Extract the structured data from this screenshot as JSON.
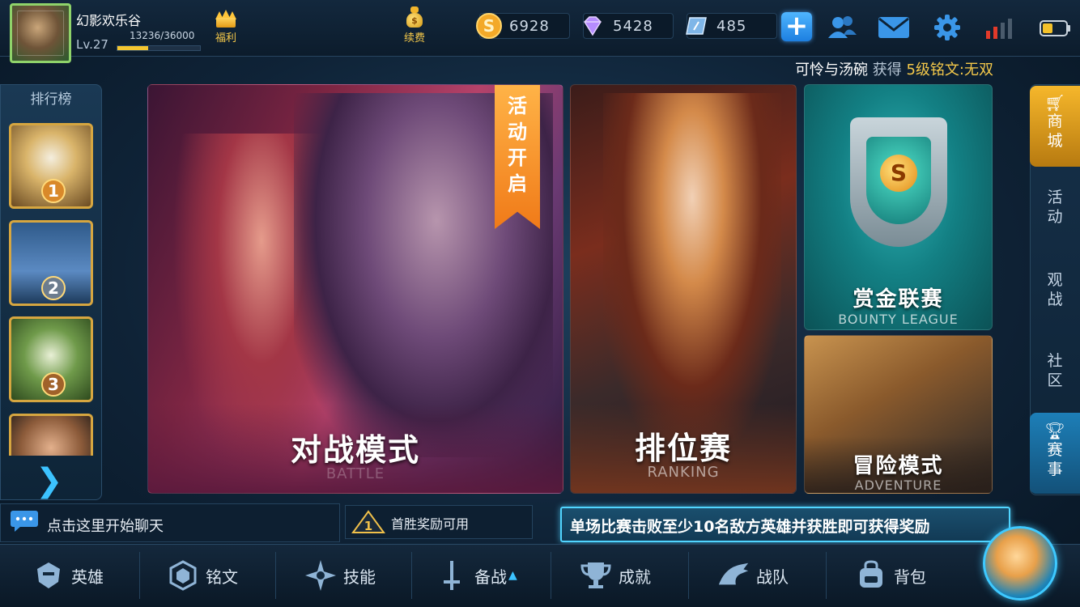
{
  "player": {
    "name": "幻影欢乐谷",
    "level": "Lv.27",
    "exp_text": "13236/36000",
    "exp_fraction": 0.37
  },
  "top_buttons": {
    "welfare": "福利",
    "renew": "续费"
  },
  "currencies": [
    {
      "icon": "gold-coin-icon",
      "value": "6928",
      "color": "#f3a928"
    },
    {
      "icon": "diamond-icon",
      "value": "5428",
      "color": "#b68cff"
    },
    {
      "icon": "voucher-icon",
      "value": "485",
      "color": "#7fb6e8"
    }
  ],
  "announcement": {
    "player": "可怜与汤碗",
    "verb": "获得",
    "item": "5级铭文:无双"
  },
  "leaderboard": {
    "title": "排行榜",
    "ranks": [
      "1",
      "2",
      "3"
    ]
  },
  "modes": {
    "battle": {
      "title": "对战模式",
      "subtitle": "BATTLE",
      "ribbon": [
        "活",
        "动",
        "开",
        "启"
      ]
    },
    "ranking": {
      "title": "排位赛",
      "subtitle": "RANKING"
    },
    "bounty": {
      "title": "赏金联赛",
      "subtitle": "BOUNTY LEAGUE"
    },
    "adventure": {
      "title": "冒险模式",
      "subtitle": "ADVENTURE"
    }
  },
  "right_nav": {
    "shop": [
      "商",
      "城"
    ],
    "activity": [
      "活",
      "动"
    ],
    "spectate": [
      "观",
      "战"
    ],
    "community": [
      "社",
      "区"
    ],
    "tournament": [
      "赛",
      "事"
    ]
  },
  "chat": {
    "placeholder": "点击这里开始聊天"
  },
  "first_win": {
    "text": "首胜奖励可用"
  },
  "tip": {
    "text": "单场比赛击败至少10名敌方英雄并获胜即可获得奖励"
  },
  "bottom_nav": [
    {
      "key": "heroes",
      "label": "英雄",
      "icon": "helmet-icon"
    },
    {
      "key": "inscriptions",
      "label": "铭文",
      "icon": "hexagon-rune-icon"
    },
    {
      "key": "skills",
      "label": "技能",
      "icon": "star-burst-icon"
    },
    {
      "key": "prepare",
      "label": "备战",
      "icon": "sword-icon"
    },
    {
      "key": "achievements",
      "label": "成就",
      "icon": "trophy-icon"
    },
    {
      "key": "team",
      "label": "战队",
      "icon": "dragon-icon"
    },
    {
      "key": "bag",
      "label": "背包",
      "icon": "backpack-icon"
    }
  ]
}
